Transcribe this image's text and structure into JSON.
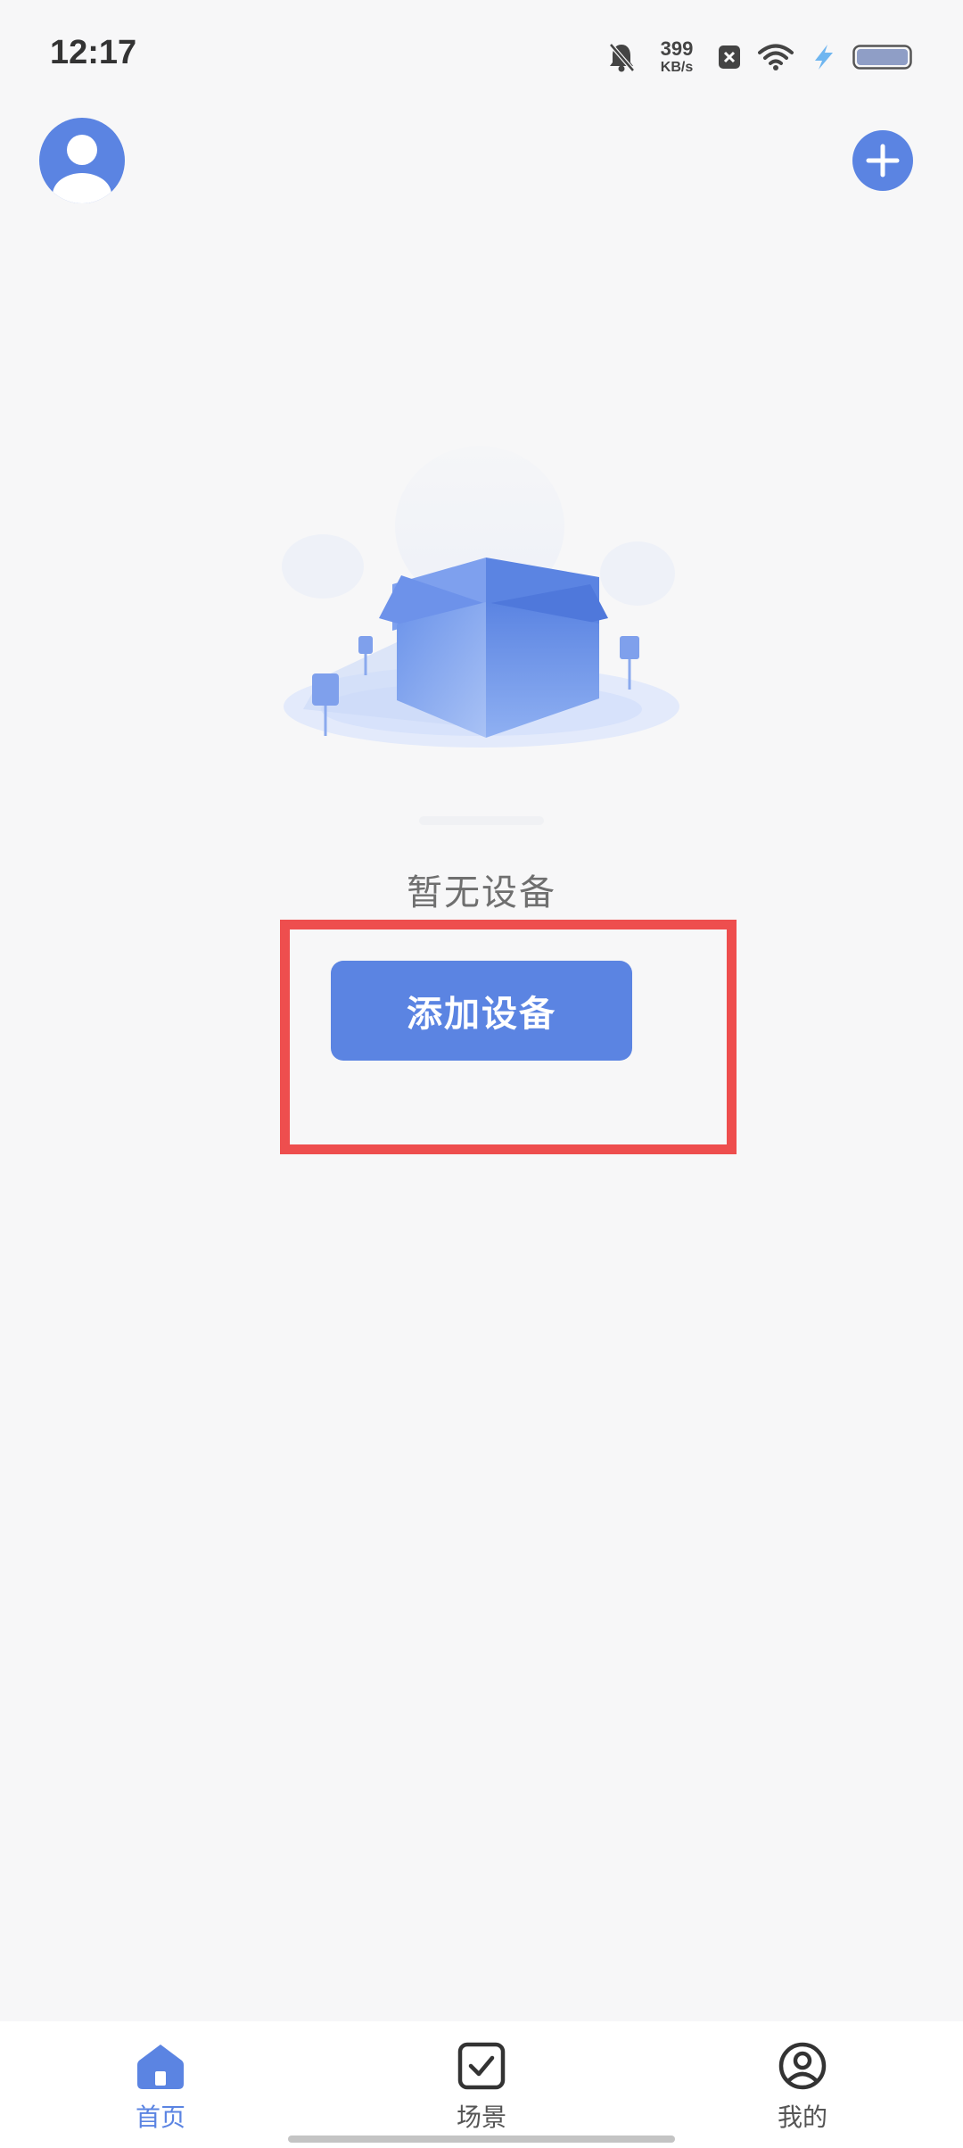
{
  "status_bar": {
    "time": "12:17",
    "net_speed_value": "399",
    "net_speed_unit": "KB/s",
    "icons": [
      "bell-off-icon",
      "close-box-icon",
      "wifi-icon",
      "charging-icon",
      "battery-icon"
    ]
  },
  "header": {
    "avatar_icon": "user-avatar-icon",
    "add_icon": "plus-icon"
  },
  "empty_state": {
    "illustration": "empty-box-illustration",
    "message": "暂无设备",
    "add_device_label": "添加设备"
  },
  "bottom_nav": {
    "items": [
      {
        "label": "首页",
        "icon": "home-icon",
        "active": true
      },
      {
        "label": "场景",
        "icon": "scene-check-icon",
        "active": false
      },
      {
        "label": "我的",
        "icon": "profile-icon",
        "active": false
      }
    ]
  },
  "colors": {
    "accent": "#5b84e2",
    "background": "#f7f7f8",
    "highlight": "#ee4e4e",
    "nav_inactive": "#555555"
  }
}
